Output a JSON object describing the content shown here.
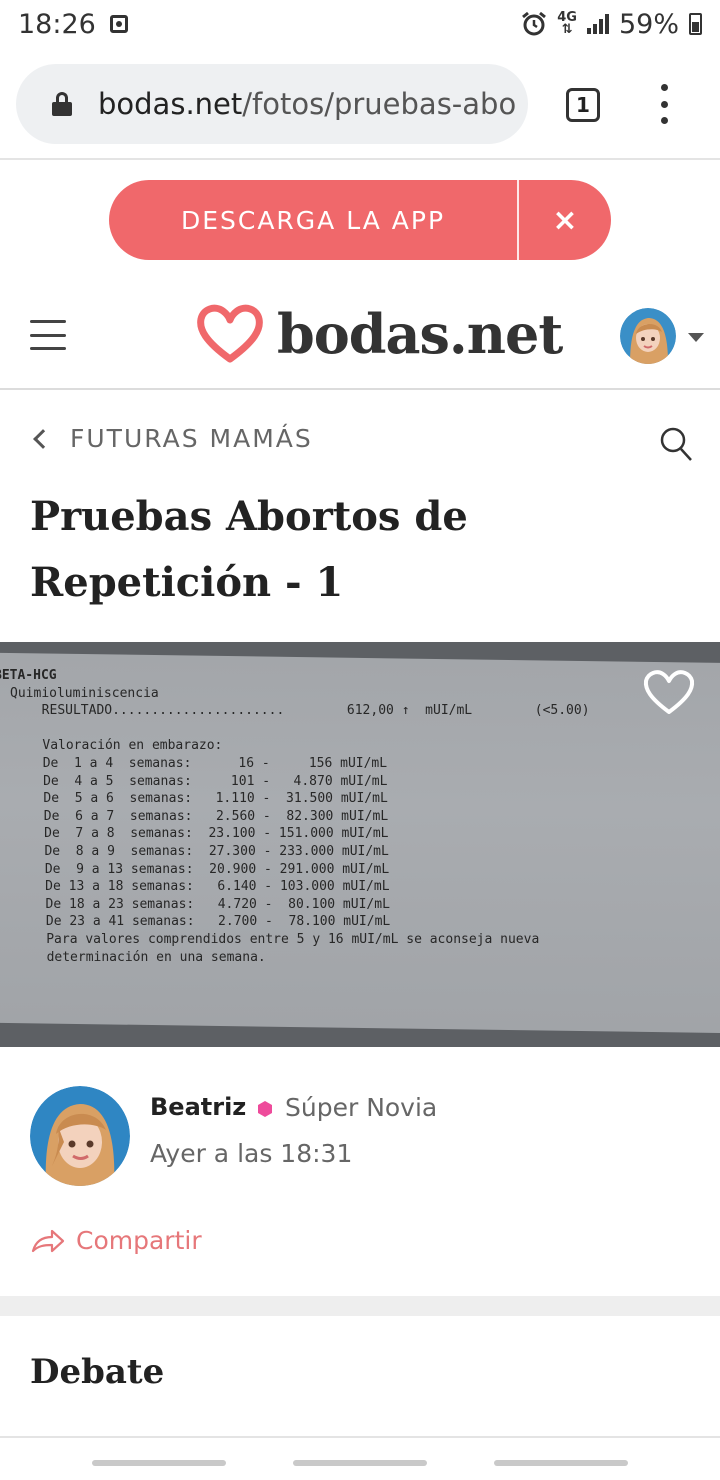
{
  "status": {
    "time": "18:26",
    "network": "4G",
    "battery": "59%"
  },
  "browser": {
    "url_host": "bodas.net",
    "url_path": "/fotos/pruebas-abo",
    "tab_count": "1"
  },
  "app_banner": {
    "label": "DESCARGA LA APP",
    "close": "×"
  },
  "header": {
    "logo_text": "bodas.net"
  },
  "breadcrumb": {
    "label": "FUTURAS MAMÁS"
  },
  "post": {
    "title": "Pruebas Abortos de Repetición - 1",
    "photo_text": {
      "lines": [
        "BETA-HCG",
        "  Quimioluminiscencia",
        "      RESULTADO......................        612,00 ↑  mUI/mL        (<5.00)",
        "",
        "      Valoración en embarazo:",
        "      De  1 a 4  semanas:      16 -     156 mUI/mL",
        "      De  4 a 5  semanas:     101 -   4.870 mUI/mL",
        "      De  5 a 6  semanas:   1.110 -  31.500 mUI/mL",
        "      De  6 a 7  semanas:   2.560 -  82.300 mUI/mL",
        "      De  7 a 8  semanas:  23.100 - 151.000 mUI/mL",
        "      De  8 a 9  semanas:  27.300 - 233.000 mUI/mL",
        "      De  9 a 13 semanas:  20.900 - 291.000 mUI/mL",
        "      De 13 a 18 semanas:   6.140 - 103.000 mUI/mL",
        "      De 18 a 23 semanas:   4.720 -  80.100 mUI/mL",
        "      De 23 a 41 semanas:   2.700 -  78.100 mUI/mL",
        "      Para valores comprendidos entre 5 y 16 mUI/mL se aconseja nueva",
        "      determinación en una semana."
      ]
    }
  },
  "author": {
    "name": "Beatriz",
    "rank": "Súper Novia",
    "time": "Ayer a las 18:31"
  },
  "actions": {
    "share": "Compartir"
  },
  "sections": {
    "debate": "Debate"
  },
  "colors": {
    "brand": "#f0686b",
    "rank_badge": "#ee4b9b"
  }
}
